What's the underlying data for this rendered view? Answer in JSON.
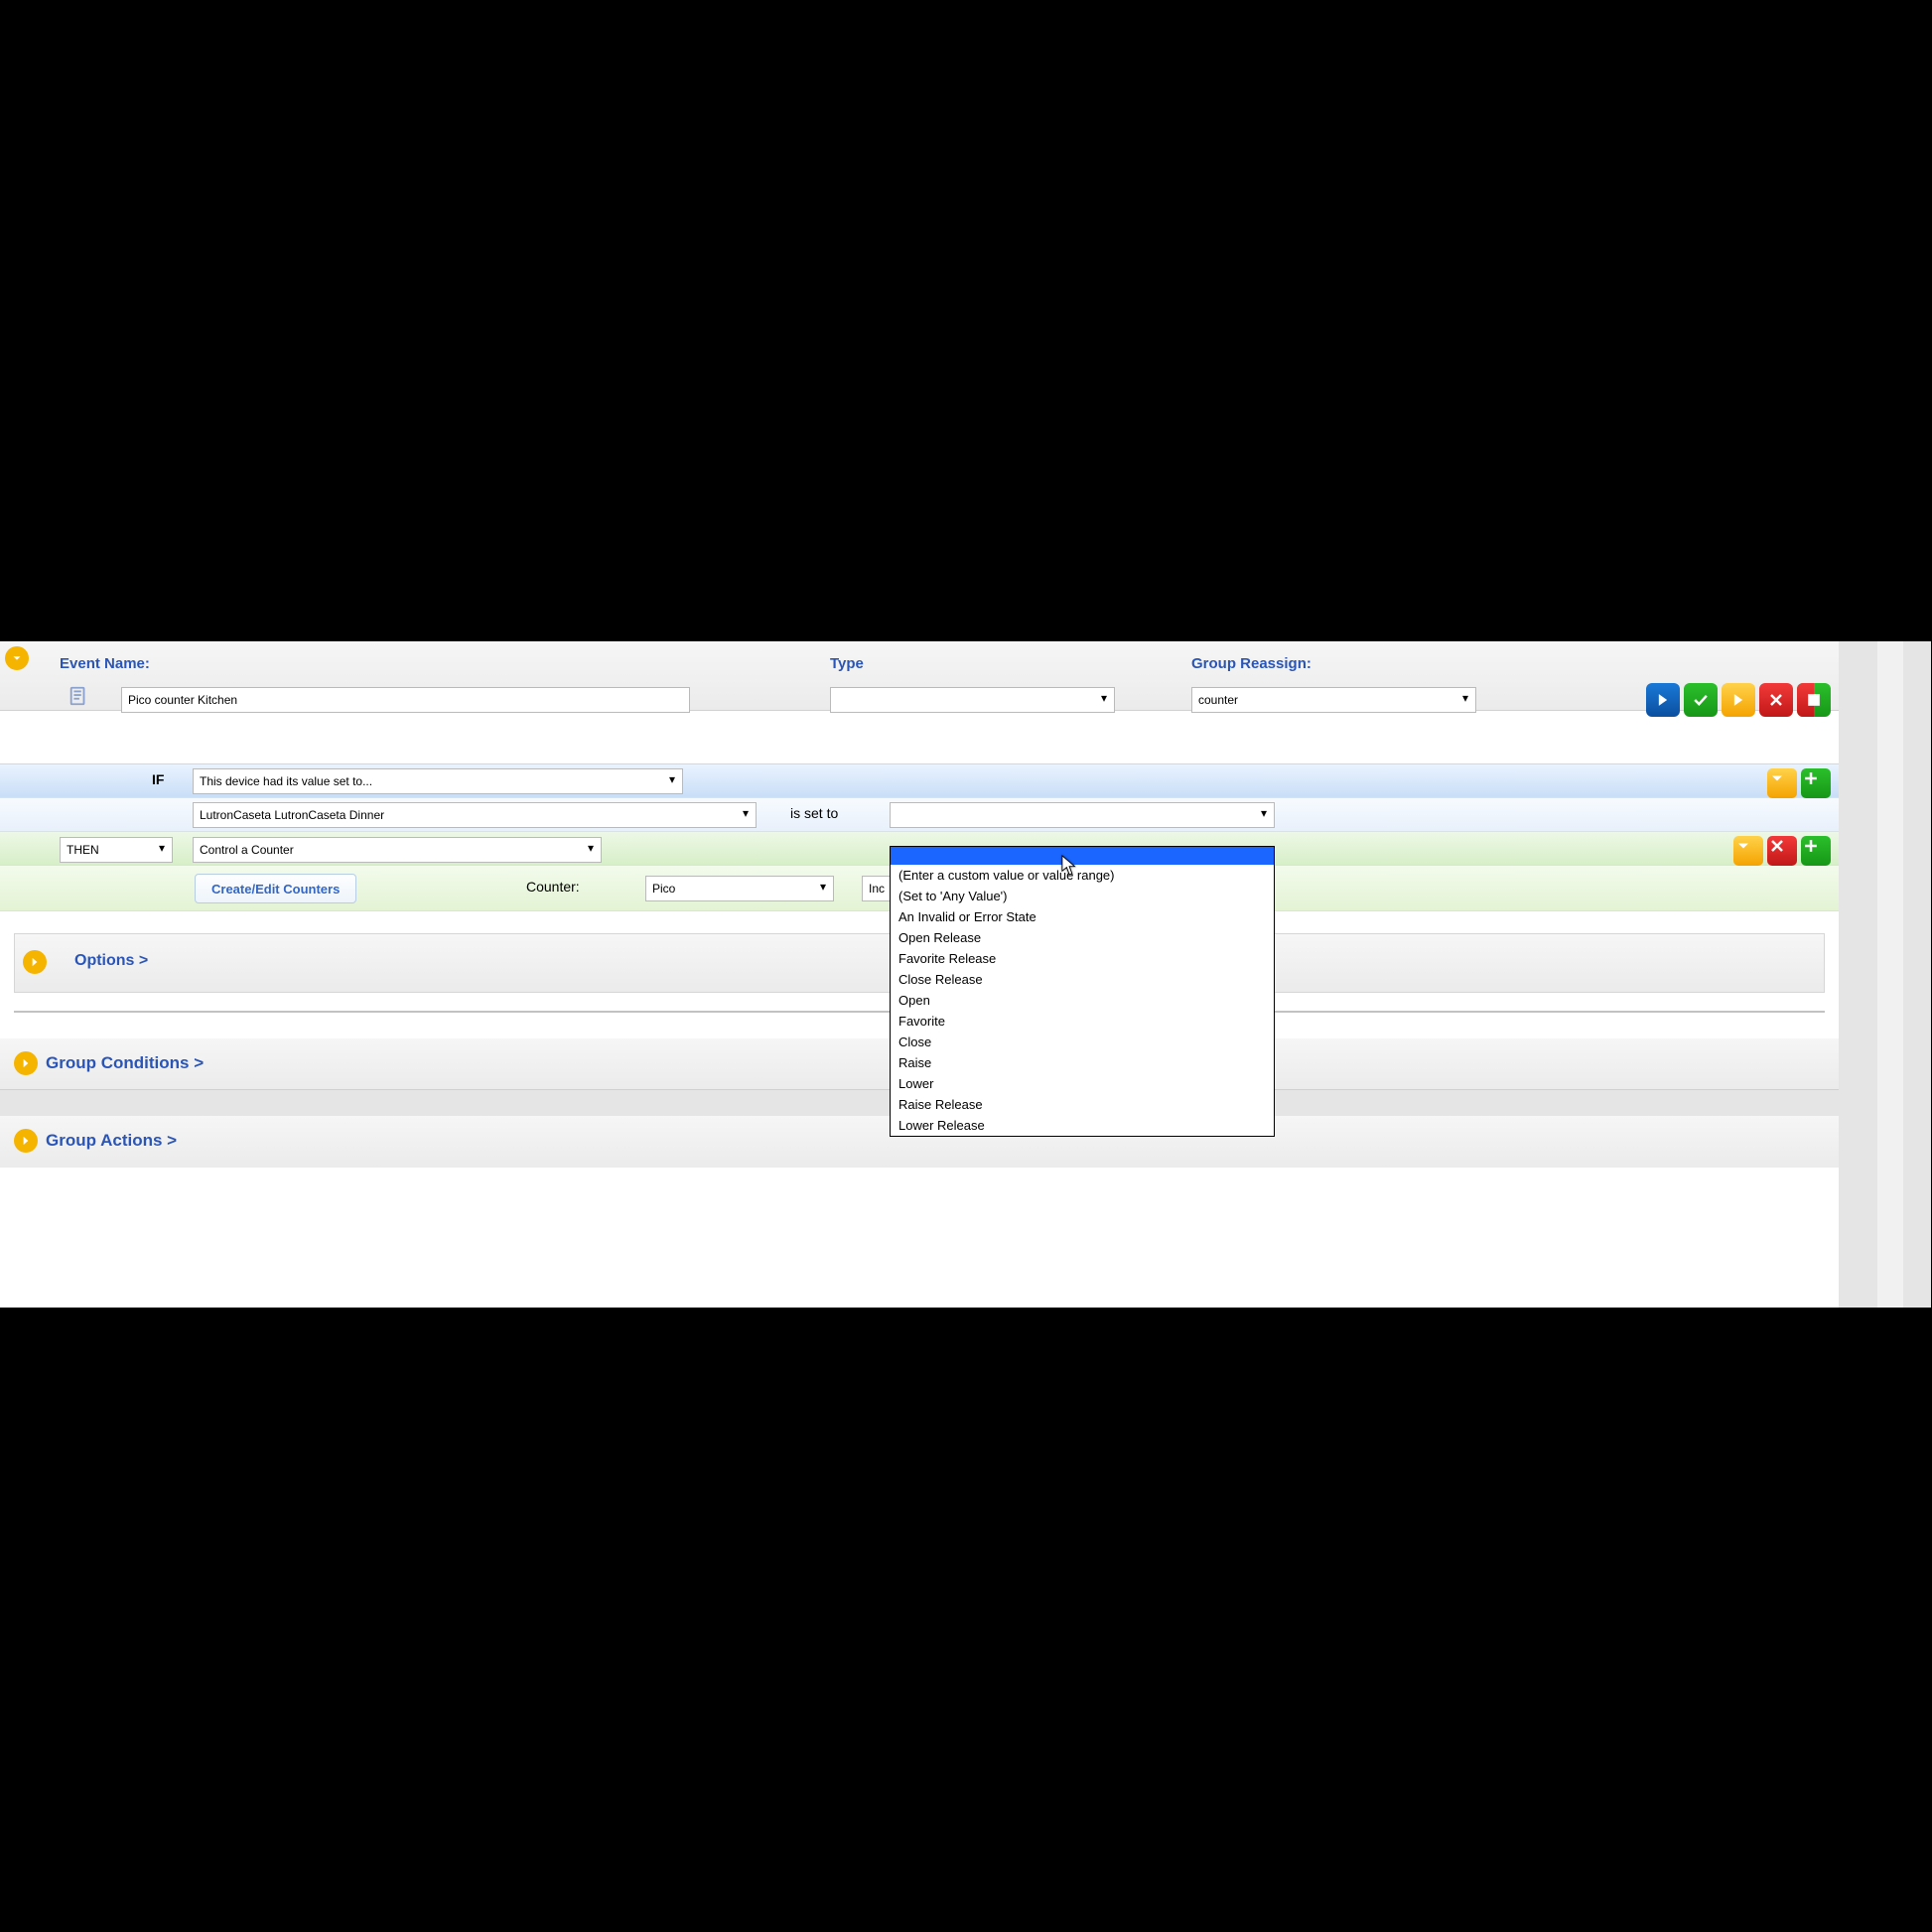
{
  "header": {
    "eventNameLabel": "Event Name:",
    "eventNameValue": "Pico counter Kitchen",
    "typeLabel": "Type",
    "typeValue": "",
    "groupLabel": "Group Reassign:",
    "groupValue": "counter"
  },
  "ifRow": {
    "kw": "IF",
    "condition": "This device had its value set to..."
  },
  "devRow": {
    "device": "LutronCaseta LutronCaseta Dinner",
    "midText": "is set to",
    "value": ""
  },
  "thenRow": {
    "kw": "THEN",
    "action": "Control a Counter"
  },
  "counterRow": {
    "editBtn": "Create/Edit Counters",
    "label": "Counter:",
    "counterValue": "Pico",
    "incPrefix": "Inc"
  },
  "options": {
    "label": "Options >"
  },
  "groups": {
    "conditions": "Group Conditions >",
    "actions": "Group Actions >"
  },
  "dropdown": {
    "items": [
      "",
      "(Enter a custom value or value range)",
      "(Set to 'Any Value')",
      "An Invalid or Error State",
      "Open Release",
      "Favorite Release",
      "Close Release",
      "Open",
      "Favorite",
      "Close",
      "Raise",
      "Lower",
      "Raise Release",
      "Lower Release"
    ]
  }
}
